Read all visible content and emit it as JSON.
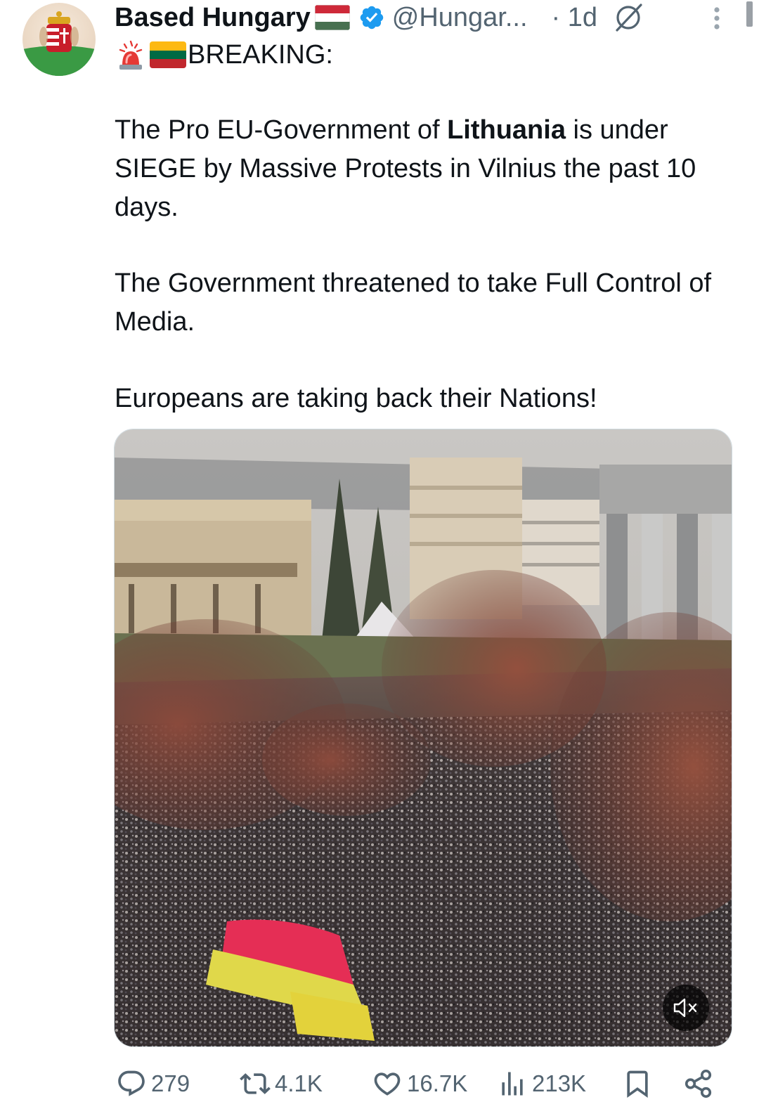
{
  "tweet": {
    "author_name": "Based Hungary",
    "handle": "@Hungar...",
    "time": "· 1d",
    "headline": "BREAKING:",
    "paragraph1_part1": "The Pro EU-Government of ",
    "paragraph1_bold": "Lithuania",
    "paragraph1_part2": " is under SIEGE by Massive Protests in Vilnius the past 10 days.",
    "paragraph2": "The Government threatened to take Full Control of Media.",
    "paragraph3": "Europeans are taking back their Nations!"
  },
  "actions": {
    "replies": "279",
    "reposts": "4.1K",
    "likes": "16.7K",
    "views": "213K"
  },
  "icons": {
    "verified": "verified-badge-icon",
    "grok": "grok-icon",
    "more": "more-vertical-icon",
    "siren": "police-light-emoji",
    "flag_hu": "hungary-flag-emoji",
    "flag_lt": "lithuania-flag-emoji",
    "mute": "volume-muted-icon",
    "reply": "reply-icon",
    "repost": "repost-icon",
    "like": "heart-icon",
    "views": "views-chart-icon",
    "bookmark": "bookmark-icon",
    "share": "share-icon"
  },
  "colors": {
    "text_primary": "#0f1419",
    "text_secondary": "#536471",
    "verified_blue": "#1d9bf0"
  }
}
